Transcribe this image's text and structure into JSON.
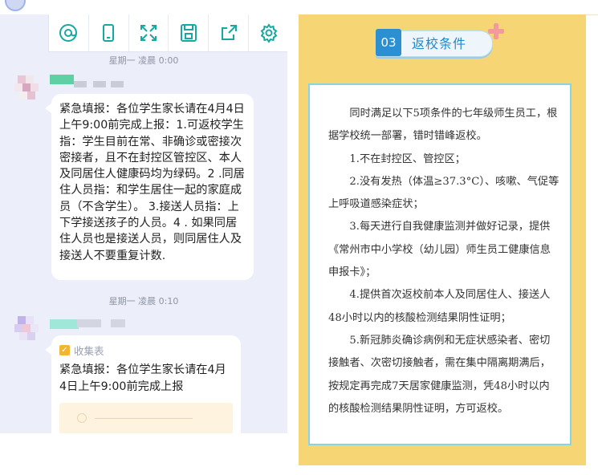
{
  "toolbar": {
    "icons": [
      "at-circle-icon",
      "phone-icon",
      "fullscreen-icon",
      "save-floppy-icon",
      "share-icon",
      "settings-gear-icon"
    ]
  },
  "chat": {
    "time1": "星期一 凌晨 0:00",
    "message1": "紧急填报：各位学生家长请在4月4日上午9:00前完成上报：1.可返校学生指：学生目前在常、非确诊或密接次密接者，且不在封控区管控区、本人及同居住人健康码均为绿码。2 .同居住人员指：和学生居住一起的家庭成员（不含学生）。 3.接送人员指：上下学接送孩子的人员。4 . 如果同居住人员也是接送人员，则同居住人及接送人不要重复计数.",
    "time2": "星期一 凌晨 0:10",
    "message2": {
      "tag": "收集表",
      "text": "紧急填报：各位学生家长请在4月4日上午9:00前完成上报"
    }
  },
  "poster": {
    "section_number": "03",
    "section_title": "返校条件",
    "intro": "同时满足以下5项条件的七年级师生员工，根据学校统一部署，错时错峰返校。",
    "items": [
      "1.不在封控区、管控区；",
      "2.没有发热（体温≥37.3°C）、咳嗽、气促等上呼吸道感染症状；",
      "3.每天进行自我健康监测并做好记录，提供《常州市中小学校（幼儿园）师生员工健康信息申报卡》；",
      "4.提供首次返校前本人及同居住人、接送人48小时以内的核酸检测结果阴性证明；",
      "5.新冠肺炎确诊病例和无症状感染者、密切接触者、次密切接触者，需在集中隔离期满后，按规定再完成7天居家健康监测，凭48小时以内的核酸检测结果阴性证明，方可返校。"
    ]
  },
  "colors": {
    "accent": "#17a8a0",
    "poster_bg": "#f6d575",
    "card_border": "#86d5df",
    "title_blue": "#2b8fd2",
    "chat_bg": "#eceef9"
  }
}
